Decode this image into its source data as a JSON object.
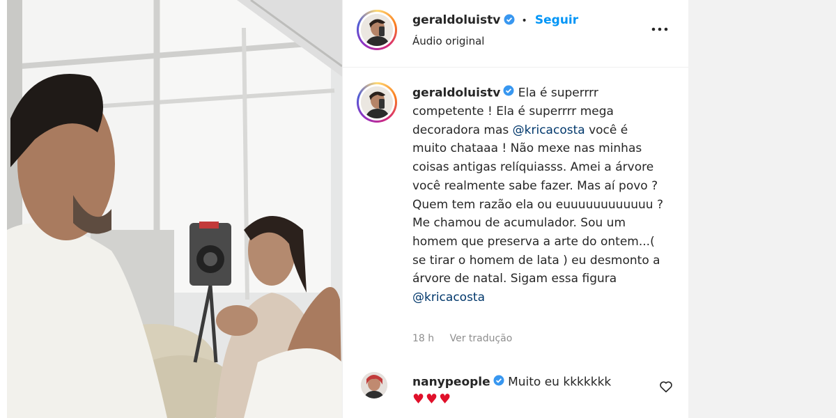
{
  "header": {
    "username": "geraldoluistv",
    "dot": "•",
    "follow_label": "Seguir",
    "subtitle": "Áudio original",
    "more_icon": "more-horizontal-icon"
  },
  "caption": {
    "username": "geraldoluistv",
    "text_1": " Ela é superrrr competente ! Ela é superrrr mega decoradora mas ",
    "mention_1": "@kricacosta",
    "text_2": " você é muito chataaa ! Não mexe nas minhas coisas antigas relíquiasss. Amei a árvore você realmente sabe fazer. Mas aí povo ? Quem tem razão ela ou euuuuuuuuuuuu ? Me chamou de acumulador. Sou um homem que preserva a arte do ontem...( se tirar o homem de lata ) eu desmonto a árvore de natal. Sigam essa figura ",
    "mention_2": "@kricacosta",
    "time": "18 h",
    "translate_label": "Ver tradução"
  },
  "comment": {
    "username": "nanypeople",
    "text": " Muito eu kkkkkkk",
    "hearts": "♥♥♥"
  },
  "colors": {
    "accent": "#0095f6",
    "mention": "#00376b",
    "verified": "#3897f0",
    "heart": "#e0102a"
  }
}
